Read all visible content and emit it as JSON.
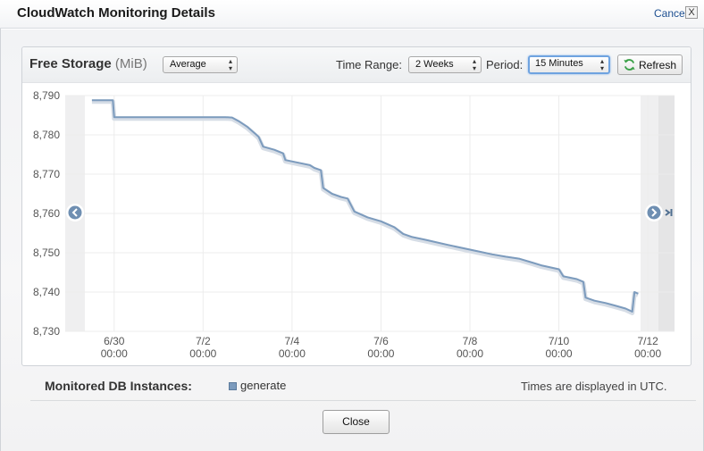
{
  "dialog": {
    "title": "CloudWatch Monitoring Details",
    "cancel_label": "Cancel",
    "cancel_x": "X",
    "close_label": "Close"
  },
  "toolbar": {
    "metric_name": "Free Storage",
    "metric_unit": "(MiB)",
    "statistic": "Average",
    "time_range_label": "Time Range:",
    "time_range": "2 Weeks",
    "period_label": "Period:",
    "period": "15 Minutes",
    "refresh_label": "Refresh"
  },
  "legend": {
    "title": "Monitored DB Instances:",
    "items": [
      "generate"
    ],
    "timezone_note": "Times are displayed in UTC."
  },
  "colors": {
    "series": "#7c9bbd",
    "nav_button": "#6f8fb2",
    "refresh_icon": "#3aa047"
  },
  "icons": {
    "prev": "chevron-left-circle-icon",
    "next": "chevron-right-circle-icon",
    "latest": "skip-to-end-icon",
    "refresh": "refresh-arrows-icon"
  },
  "chart_data": {
    "type": "line",
    "series": [
      {
        "name": "generate",
        "points": [
          [
            0.0,
            8788.8
          ],
          [
            0.47,
            8788.8
          ],
          [
            0.5,
            8784.5
          ],
          [
            1.0,
            8784.5
          ],
          [
            2.0,
            8784.5
          ],
          [
            3.0,
            8784.5
          ],
          [
            3.15,
            8784.4
          ],
          [
            3.3,
            8783.5
          ],
          [
            3.5,
            8782.0
          ],
          [
            3.7,
            8780.0
          ],
          [
            3.75,
            8779.5
          ],
          [
            3.85,
            8777.0
          ],
          [
            4.1,
            8776.2
          ],
          [
            4.3,
            8775.3
          ],
          [
            4.35,
            8773.6
          ],
          [
            4.6,
            8773.0
          ],
          [
            4.9,
            8772.3
          ],
          [
            5.0,
            8771.6
          ],
          [
            5.15,
            8771.0
          ],
          [
            5.2,
            8766.5
          ],
          [
            5.4,
            8765.0
          ],
          [
            5.6,
            8764.2
          ],
          [
            5.75,
            8763.8
          ],
          [
            5.9,
            8760.5
          ],
          [
            6.2,
            8759.0
          ],
          [
            6.5,
            8758.0
          ],
          [
            6.8,
            8756.5
          ],
          [
            7.0,
            8754.8
          ],
          [
            7.2,
            8754.0
          ],
          [
            7.5,
            8753.3
          ],
          [
            8.0,
            8752.0
          ],
          [
            8.5,
            8750.8
          ],
          [
            9.0,
            8749.6
          ],
          [
            9.3,
            8749.0
          ],
          [
            9.6,
            8748.5
          ],
          [
            9.9,
            8747.5
          ],
          [
            10.1,
            8746.8
          ],
          [
            10.5,
            8745.8
          ],
          [
            10.6,
            8744.0
          ],
          [
            10.9,
            8743.3
          ],
          [
            11.05,
            8742.6
          ],
          [
            11.1,
            8738.6
          ],
          [
            11.3,
            8737.8
          ],
          [
            11.55,
            8737.2
          ],
          [
            11.75,
            8736.6
          ],
          [
            12.0,
            8735.8
          ],
          [
            12.15,
            8735.0
          ],
          [
            12.2,
            8740.0
          ],
          [
            12.28,
            8739.6
          ]
        ]
      }
    ],
    "x_tick_labels": [
      {
        "date": "6/30",
        "time": "00:00"
      },
      {
        "date": "7/2",
        "time": "00:00"
      },
      {
        "date": "7/4",
        "time": "00:00"
      },
      {
        "date": "7/6",
        "time": "00:00"
      },
      {
        "date": "7/8",
        "time": "00:00"
      },
      {
        "date": "7/10",
        "time": "00:00"
      },
      {
        "date": "7/12",
        "time": "00:00"
      }
    ],
    "x_ticks": [
      0.5,
      2.5,
      4.5,
      6.5,
      8.5,
      10.5,
      12.5
    ],
    "xlim": [
      -0.6,
      13.1
    ],
    "y_ticks": [
      8730,
      8740,
      8750,
      8760,
      8770,
      8780,
      8790
    ],
    "y_tick_labels": [
      "8,730",
      "8,740",
      "8,750",
      "8,760",
      "8,770",
      "8,780",
      "8,790"
    ],
    "ylim": [
      8730,
      8790
    ],
    "grid": true
  }
}
